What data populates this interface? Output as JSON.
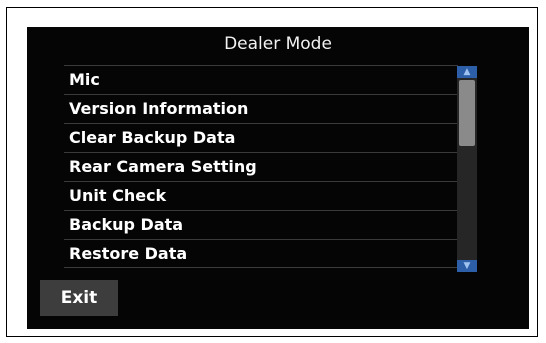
{
  "header": {
    "title": "Dealer Mode"
  },
  "menu": {
    "items": [
      {
        "label": "Mic"
      },
      {
        "label": "Version Information"
      },
      {
        "label": "Clear Backup Data"
      },
      {
        "label": "Rear Camera Setting"
      },
      {
        "label": "Unit Check"
      },
      {
        "label": "Backup Data"
      },
      {
        "label": "Restore Data"
      }
    ]
  },
  "footer": {
    "exit_label": "Exit"
  },
  "icons": {
    "scroll_up": "chevron-up-icon",
    "scroll_down": "chevron-down-icon"
  },
  "colors": {
    "background": "#050505",
    "accent": "#2c5fa8",
    "button": "#3d3d3d"
  }
}
